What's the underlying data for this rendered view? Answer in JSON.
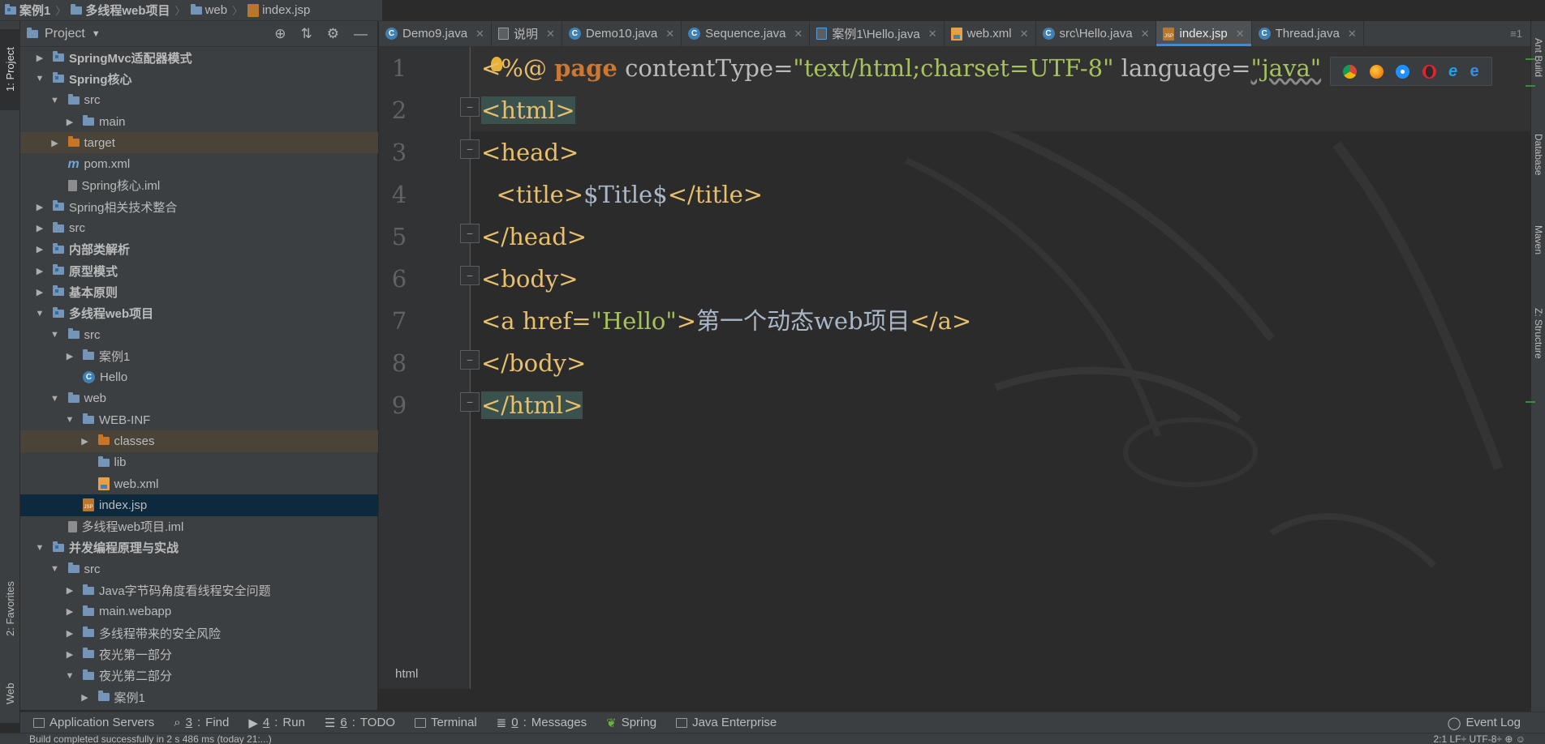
{
  "breadcrumb": [
    {
      "label": "案例1",
      "icon": "module-folder-icon",
      "bold": true
    },
    {
      "label": "多线程web项目",
      "icon": "folder-icon",
      "bold": true
    },
    {
      "label": "web",
      "icon": "web-folder-icon",
      "bold": false
    },
    {
      "label": "index.jsp",
      "icon": "jsp-file-icon",
      "bold": false
    }
  ],
  "left_stripe": {
    "project": "1: Project",
    "favorites": "2: Favorites",
    "web": "Web"
  },
  "project_panel": {
    "title": "Project",
    "toolbar_icons": [
      "locate-icon",
      "collapse-icon",
      "gear-icon",
      "hide-icon"
    ]
  },
  "tree": [
    {
      "label": "SpringMvc适配器模式",
      "depth": 1,
      "arrow": "right",
      "icon": "module-folder-icon",
      "bold": true
    },
    {
      "label": "Spring核心",
      "depth": 1,
      "arrow": "down",
      "icon": "module-folder-icon",
      "bold": true
    },
    {
      "label": "src",
      "depth": 2,
      "arrow": "down",
      "icon": "source-folder-icon"
    },
    {
      "label": "main",
      "depth": 3,
      "arrow": "right",
      "icon": "folder-icon"
    },
    {
      "label": "target",
      "depth": 2,
      "arrow": "right",
      "icon": "excluded-folder-icon",
      "highlight": true
    },
    {
      "label": "pom.xml",
      "depth": 2,
      "arrow": "none",
      "icon": "maven-icon"
    },
    {
      "label": "Spring核心.iml",
      "depth": 2,
      "arrow": "none",
      "icon": "iml-file-icon"
    },
    {
      "label": "Spring相关技术整合",
      "depth": 1,
      "arrow": "right",
      "icon": "module-folder-icon"
    },
    {
      "label": "src",
      "depth": 1,
      "arrow": "right",
      "icon": "source-folder-icon"
    },
    {
      "label": "内部类解析",
      "depth": 1,
      "arrow": "right",
      "icon": "module-folder-icon",
      "bold": true
    },
    {
      "label": "原型模式",
      "depth": 1,
      "arrow": "right",
      "icon": "module-folder-icon",
      "bold": true
    },
    {
      "label": "基本原则",
      "depth": 1,
      "arrow": "right",
      "icon": "module-folder-icon",
      "bold": true
    },
    {
      "label": "多线程web项目",
      "depth": 1,
      "arrow": "down",
      "icon": "module-folder-icon",
      "bold": true
    },
    {
      "label": "src",
      "depth": 2,
      "arrow": "down",
      "icon": "source-folder-icon"
    },
    {
      "label": "案例1",
      "depth": 3,
      "arrow": "right",
      "icon": "package-icon"
    },
    {
      "label": "Hello",
      "depth": 3,
      "arrow": "none",
      "icon": "java-class-icon"
    },
    {
      "label": "web",
      "depth": 2,
      "arrow": "down",
      "icon": "web-folder-icon"
    },
    {
      "label": "WEB-INF",
      "depth": 3,
      "arrow": "down",
      "icon": "folder-icon"
    },
    {
      "label": "classes",
      "depth": 4,
      "arrow": "right",
      "icon": "excluded-folder-icon",
      "highlight": true
    },
    {
      "label": "lib",
      "depth": 4,
      "arrow": "none",
      "icon": "folder-icon"
    },
    {
      "label": "web.xml",
      "depth": 4,
      "arrow": "none",
      "icon": "xml-file-icon"
    },
    {
      "label": "index.jsp",
      "depth": 3,
      "arrow": "none",
      "icon": "jsp-file-icon",
      "selected": true
    },
    {
      "label": "多线程web项目.iml",
      "depth": 2,
      "arrow": "none",
      "icon": "iml-file-icon"
    },
    {
      "label": "并发编程原理与实战",
      "depth": 1,
      "arrow": "down",
      "icon": "module-folder-icon",
      "bold": true
    },
    {
      "label": "src",
      "depth": 2,
      "arrow": "down",
      "icon": "source-folder-icon"
    },
    {
      "label": "Java字节码角度看线程安全问题",
      "depth": 3,
      "arrow": "right",
      "icon": "package-icon"
    },
    {
      "label": "main.webapp",
      "depth": 3,
      "arrow": "right",
      "icon": "package-icon"
    },
    {
      "label": "多线程带来的安全风险",
      "depth": 3,
      "arrow": "right",
      "icon": "package-icon"
    },
    {
      "label": "夜光第一部分",
      "depth": 3,
      "arrow": "right",
      "icon": "package-icon"
    },
    {
      "label": "夜光第二部分",
      "depth": 3,
      "arrow": "down",
      "icon": "package-icon"
    },
    {
      "label": "案例1",
      "depth": 4,
      "arrow": "right",
      "icon": "package-icon"
    }
  ],
  "tabs": [
    {
      "label": "Demo9.java",
      "icon": "java-class-icon"
    },
    {
      "label": "说明",
      "icon": "text-file-icon"
    },
    {
      "label": "Demo10.java",
      "icon": "java-class-icon"
    },
    {
      "label": "Sequence.java",
      "icon": "java-class-icon"
    },
    {
      "label": "案例1\\Hello.java",
      "icon": "java-file-icon"
    },
    {
      "label": "web.xml",
      "icon": "xml-file-icon"
    },
    {
      "label": "src\\Hello.java",
      "icon": "java-class-icon"
    },
    {
      "label": "index.jsp",
      "icon": "jsp-file-icon",
      "active": true
    },
    {
      "label": "Thread.java",
      "icon": "java-class-icon"
    }
  ],
  "tab_menu": "≡1",
  "line_numbers": [
    "1",
    "2",
    "3",
    "4",
    "5",
    "6",
    "7",
    "8",
    "9"
  ],
  "code": {
    "l1_open": "<%@ ",
    "l1_kw": "page",
    "l1_attr1": " contentType=",
    "l1_val1": "\"text/html;charset=UTF-8\"",
    "l1_attr2": " language=",
    "l1_val2": "\"java\"",
    "l1_close": " %>",
    "l2": "<html>",
    "l3": "<head>",
    "l4_open": "<title>",
    "l4_text": "$Title$",
    "l4_close": "</title>",
    "l5": "</head>",
    "l6": "<body>",
    "l7_open": "<a href=",
    "l7_val": "\"Hello\"",
    "l7_gt": ">",
    "l7_text": "第一个动态web项目",
    "l7_close": "</a>",
    "l8": "</body>",
    "l9": "</html>"
  },
  "browser_icons": [
    "chrome-icon",
    "firefox-icon",
    "safari-icon",
    "opera-icon",
    "ie-icon",
    "edge-icon"
  ],
  "editor_breadcrumb": "html",
  "right_stripe": {
    "ant": "Ant Build",
    "database": "Database",
    "maven": "Maven",
    "structure": "Z: Structure"
  },
  "bottom_tools": [
    {
      "label": "Application Servers",
      "mnemonic": "",
      "icon": "servers-icon"
    },
    {
      "label": "Find",
      "mnemonic": "3",
      "icon": "search-icon"
    },
    {
      "label": "Run",
      "mnemonic": "4",
      "icon": "run-icon"
    },
    {
      "label": "TODO",
      "mnemonic": "6",
      "icon": "todo-icon"
    },
    {
      "label": "Terminal",
      "mnemonic": "",
      "icon": "terminal-icon"
    },
    {
      "label": "Messages",
      "mnemonic": "0",
      "icon": "messages-icon"
    },
    {
      "label": "Spring",
      "mnemonic": "",
      "icon": "spring-icon"
    },
    {
      "label": "Java Enterprise",
      "mnemonic": "",
      "icon": "java-enterprise-icon"
    }
  ],
  "event_log": "Event Log",
  "status": {
    "message": "Build completed successfully in 2 s 486 ms (today 21:...)",
    "position": "2:1  LF÷  UTF-8÷  ⊕  ☺"
  },
  "colors": {
    "accent": "#4a88c7",
    "selection": "#0d293e",
    "tag": "#e8bf6a",
    "string": "#a5c25c",
    "keyword": "#cc7832"
  }
}
